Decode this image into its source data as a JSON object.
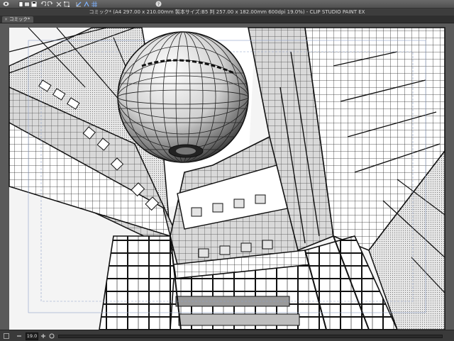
{
  "window": {
    "title": "コミック* (A4 297.00 x 210.00mm 製本サイズ:B5 判 257.00 x 182.00mm 600dpi 19.0%) - CLIP STUDIO PAINT EX"
  },
  "tabs": [
    {
      "label": "コミック*"
    }
  ],
  "toolbar": {
    "icons": [
      "app-menu-icon",
      "new-file-icon",
      "open-file-icon",
      "save-icon",
      "undo-icon",
      "redo-icon",
      "clear-icon",
      "transform-icon",
      "snap-ruler-icon",
      "snap-special-ruler-icon",
      "snap-grid-icon",
      "help-icon"
    ]
  },
  "statusbar": {
    "zoom_value": "19.0"
  },
  "colors": {
    "ui_dark": "#3a3a3a",
    "canvas_bg": "#5a5a5a",
    "paper": "#ffffff",
    "line": "#111111",
    "tone": "#9a9a9a"
  }
}
